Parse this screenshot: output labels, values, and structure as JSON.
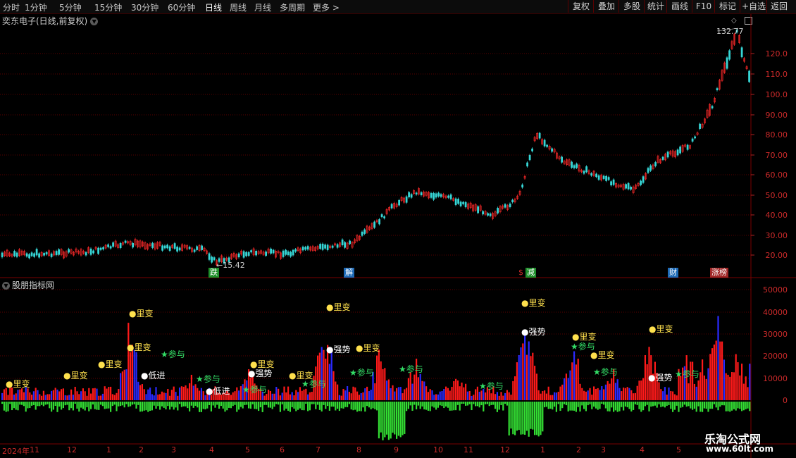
{
  "toolbar": {
    "periods": [
      "分时",
      "1分钟",
      "5分钟",
      "15分钟",
      "30分钟",
      "60分钟",
      "日线",
      "周线",
      "月线",
      "多周期",
      "更多 >"
    ],
    "active_period": "日线",
    "buttons": [
      "复权",
      "叠加",
      "多股",
      "统计",
      "画线",
      "F10",
      "标记",
      "+自选",
      "返回"
    ]
  },
  "stock": {
    "title": "奕东电子(日线,前复权)",
    "high_label": "132.77",
    "low_label": "←15.42"
  },
  "indicator": {
    "title": "股朋指标网"
  },
  "price_axis": [
    "120.0",
    "110.0",
    "100.0",
    "90.00",
    "80.00",
    "70.00",
    "60.00",
    "50.00",
    "40.00",
    "30.00",
    "20.00"
  ],
  "volume_axis": [
    "50000",
    "40000",
    "30000",
    "20000",
    "10000",
    "0"
  ],
  "date_axis": [
    "2024年",
    "11",
    "12",
    "1",
    "2",
    "3",
    "4",
    "5",
    "6",
    "7",
    "8",
    "9",
    "10",
    "11",
    "12",
    "1",
    "2",
    "3",
    "4",
    "5"
  ],
  "event_tags": [
    {
      "text": "跌",
      "color": "#1e8f2a"
    },
    {
      "text": "解",
      "color": "#1e6bb8"
    },
    {
      "text": "$",
      "color": "#cc2a2a"
    },
    {
      "text": "减",
      "color": "#1e8f2a"
    },
    {
      "text": "财",
      "color": "#1e6bb8"
    },
    {
      "text": "涨榜",
      "color": "#a02525"
    }
  ],
  "signals": [
    "里变",
    "里变",
    "里变",
    "里变",
    "里变",
    "里变",
    "里变",
    "里变",
    "里变",
    "里变",
    "里变",
    "里变",
    "里变",
    "参与",
    "参与",
    "参与",
    "参与",
    "参与",
    "参与",
    "参与",
    "参与",
    "参与",
    "参与",
    "低进",
    "低进",
    "强势",
    "强势",
    "强势",
    "强势"
  ],
  "watermark": {
    "line1": "乐淘公式网",
    "line2": "www.60lt.com"
  },
  "colors": {
    "up": "#ff2a2a",
    "down": "#36d6d6",
    "grid": "#5a0000",
    "vol_up": "#ff1a1a",
    "vol_down": "#2a2aff",
    "neg_bar": "#33dd33",
    "signal_yellow": "#ffe14d",
    "signal_green": "#33dd66"
  }
}
